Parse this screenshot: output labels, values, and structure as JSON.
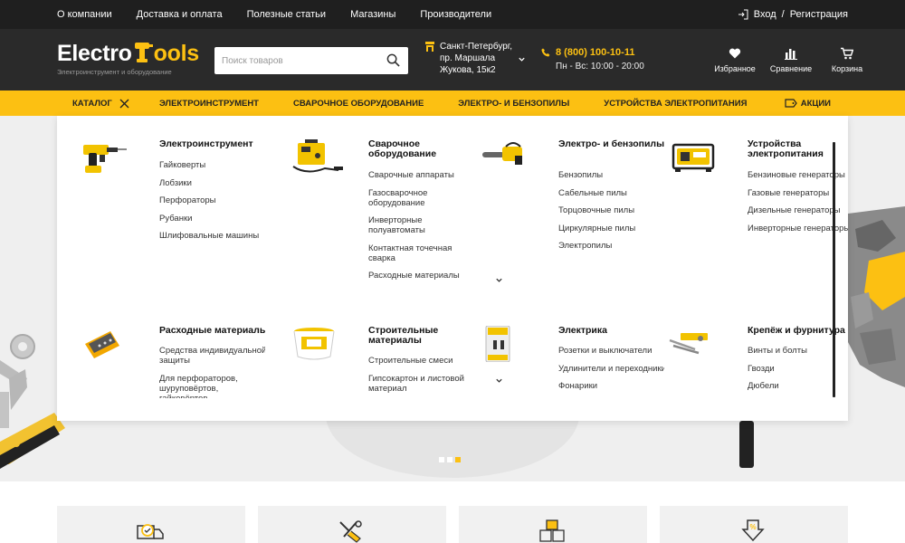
{
  "topbar": {
    "nav": [
      "О компании",
      "Доставка и оплата",
      "Полезные статьи",
      "Магазины",
      "Производители"
    ],
    "login": "Вход",
    "separator": "/",
    "register": "Регистрация"
  },
  "header": {
    "logo_part1": "Electro",
    "logo_part2": "ools",
    "logo_sub": "Электроинструмент и оборудование",
    "search_placeholder": "Поиск товаров",
    "city_line1": "Санкт-Петербург,",
    "city_line2": "пр. Маршала",
    "city_line3": "Жукова, 15к2",
    "phone": "8 (800) 100-10-11",
    "hours": "Пн - Вс: 10:00 - 20:00",
    "icons": [
      {
        "label": "Избранное",
        "icon": "heart-icon"
      },
      {
        "label": "Сравнение",
        "icon": "compare-icon"
      },
      {
        "label": "Корзина",
        "icon": "cart-icon"
      }
    ]
  },
  "catbar": {
    "catalog": "Каталог",
    "items": [
      "Электроинструмент",
      "Сварочное оборудование",
      "Электро- и бензопилы",
      "Устройства электропитания"
    ],
    "promo": "Акции"
  },
  "dropdown": {
    "categories": [
      {
        "title": "Электроинструмент",
        "items": [
          "Гайковерты",
          "Лобзики",
          "Перфораторы",
          "Рубанки",
          "Шлифовальные машины"
        ],
        "image": "drill-image"
      },
      {
        "title": "Сварочное оборудование",
        "items": [
          "Сварочные аппараты",
          "Газосварочное оборудование",
          "Инверторные полуавтоматы",
          "Контактная точечная сварка",
          "Расходные материалы"
        ],
        "image": "welder-image",
        "more": true
      },
      {
        "title": "Электро- и бензопилы",
        "items": [
          "Бензопилы",
          "Сабельные пилы",
          "Торцовочные пилы",
          "Циркулярные пилы",
          "Электропилы"
        ],
        "image": "chainsaw-image"
      },
      {
        "title": "Устройства электропитания",
        "items": [
          "Бензиновые генераторы",
          "Газовые генераторы",
          "Дизельные генераторы",
          "Инверторные генераторы"
        ],
        "image": "generator-image"
      },
      {
        "title": "Расходные материалы",
        "items": [
          "Средства индивидуальной защиты",
          "Для перфораторов, шуруповёртов, гайковёртов"
        ],
        "image": "bits-image",
        "more": true
      },
      {
        "title": "Строительные материалы",
        "items": [
          "Строительные смеси",
          "Гипсокартон и листовой материал"
        ],
        "image": "bucket-image",
        "more": true
      },
      {
        "title": "Электрика",
        "items": [
          "Розетки и выключатели",
          "Удлинители и переходники",
          "Фонарики"
        ],
        "image": "breaker-image"
      },
      {
        "title": "Крепёж и фурнитура",
        "items": [
          "Винты и болты",
          "Гвозди",
          "Дюбели"
        ],
        "image": "screws-image"
      }
    ]
  },
  "slider": {
    "count": 3,
    "active": 3
  },
  "bottom_cards": [
    "delivery-icon",
    "tools-icon",
    "boxes-icon",
    "discount-icon"
  ],
  "colors": {
    "accent": "#fcc012",
    "dark": "#1f1f1f",
    "header": "#2a2a2a"
  }
}
